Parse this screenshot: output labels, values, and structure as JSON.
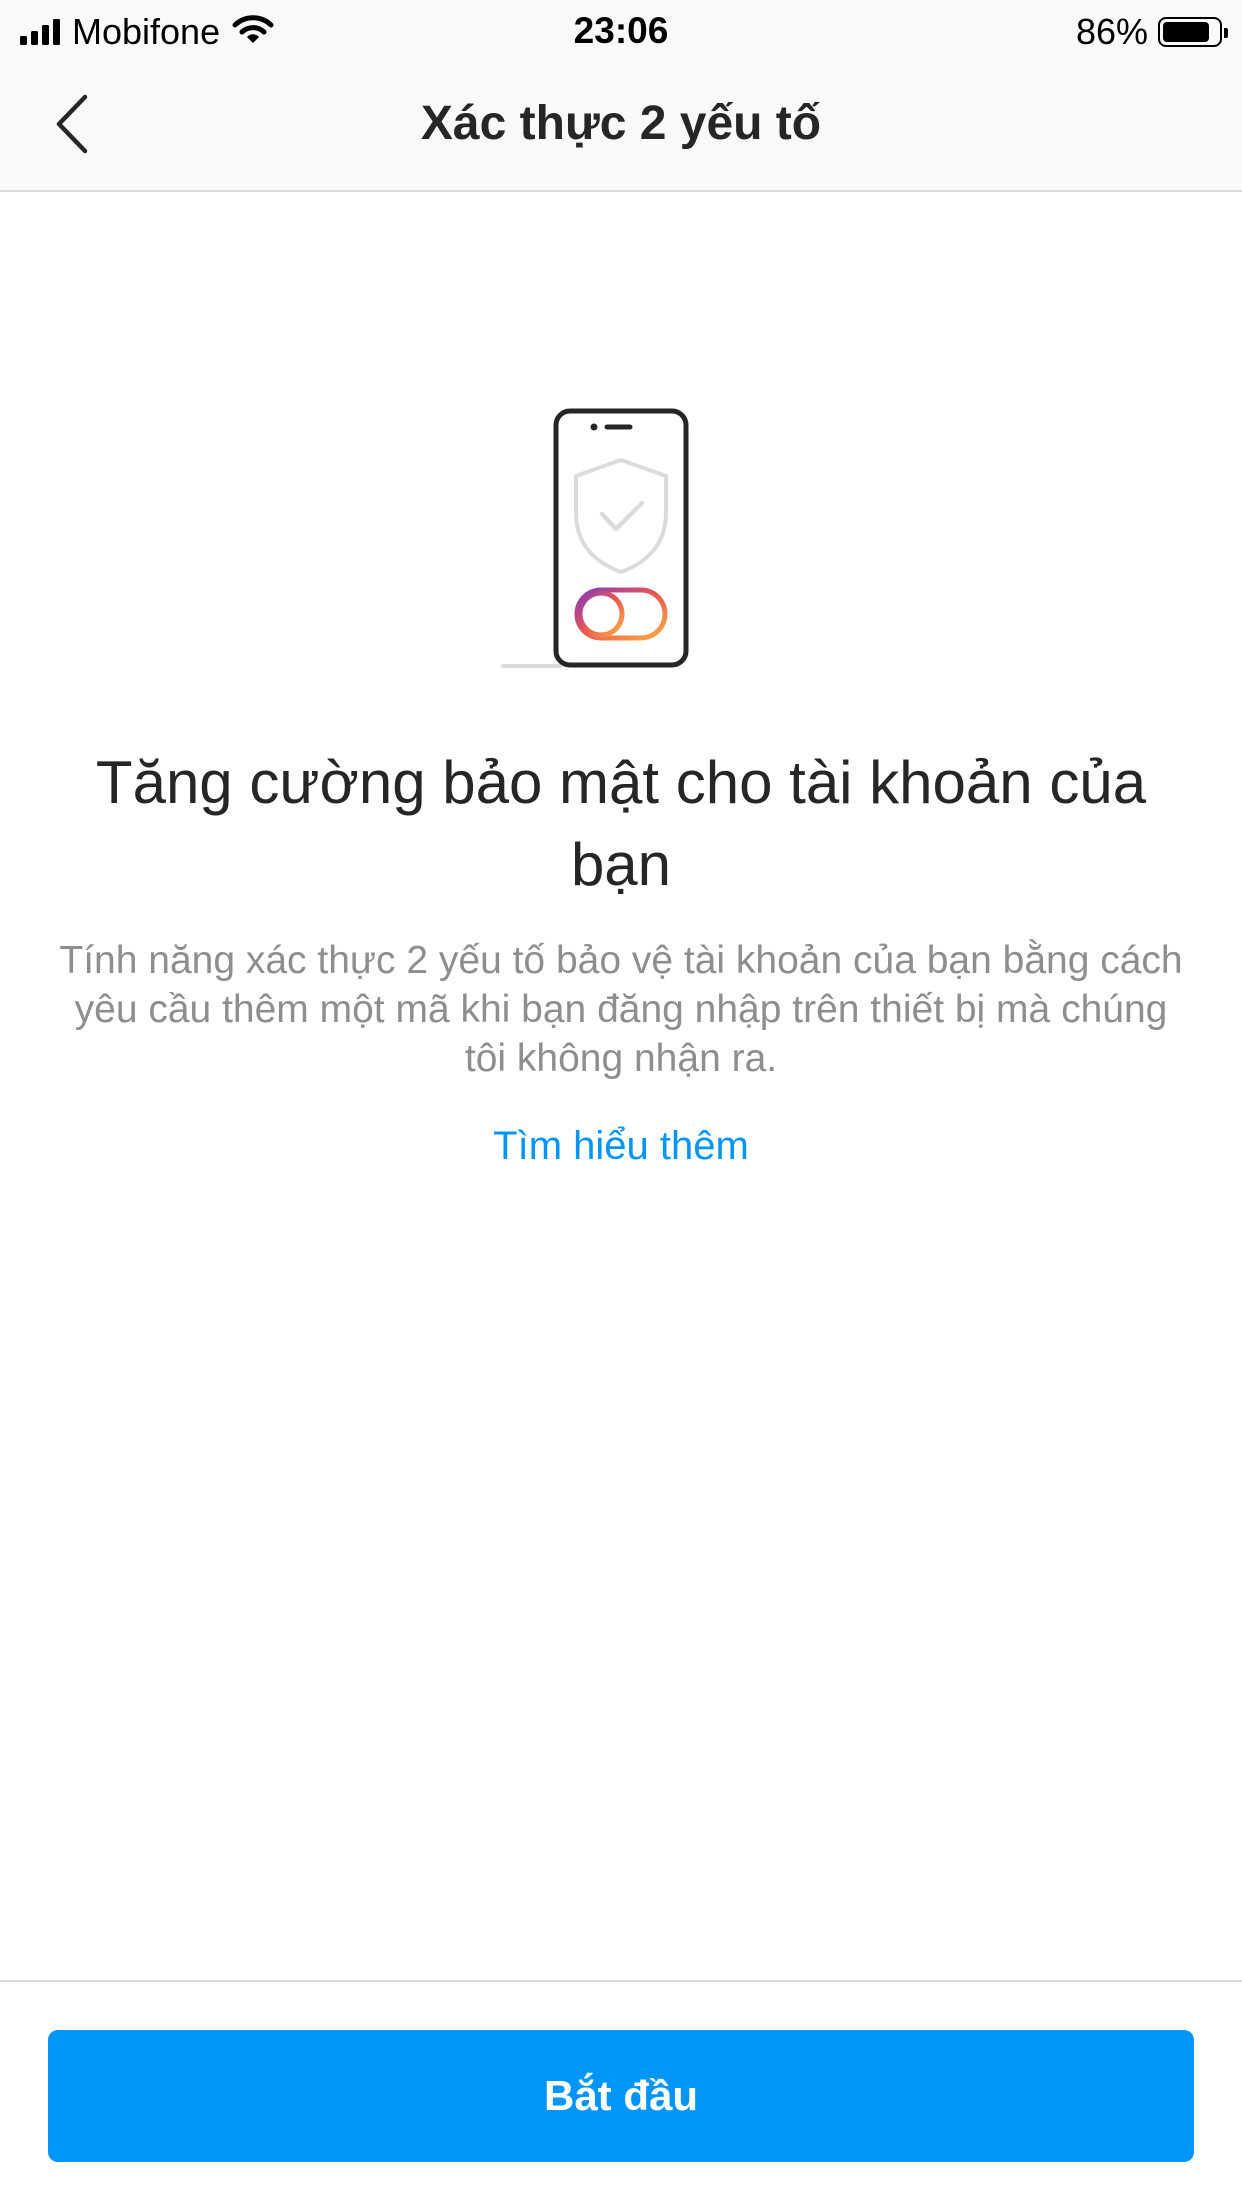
{
  "status_bar": {
    "carrier": "Mobifone",
    "time": "23:06",
    "battery_percent": "86%",
    "battery_level": 0.86,
    "icons": [
      "cellular-signal-icon",
      "wifi-icon",
      "battery-icon"
    ]
  },
  "nav": {
    "back_icon": "chevron-left-icon",
    "title": "Xác thực 2 yếu tố"
  },
  "illustration": {
    "icons": [
      "phone-icon",
      "shield-check-icon",
      "toggle-icon"
    ],
    "colors": {
      "outline": "#262626",
      "shield": "#dbdbdb",
      "toggle_start": "#8a3ab9",
      "toggle_end": "#fcaf45"
    }
  },
  "content": {
    "headline": "Tăng cường bảo mật cho tài khoản của bạn",
    "description": "Tính năng xác thực 2 yếu tố bảo vệ tài khoản của bạn bằng cách yêu cầu thêm một mã khi bạn đăng nhập trên thiết bị mà chúng tôi không nhận ra.",
    "learn_more": "Tìm hiểu thêm"
  },
  "footer": {
    "start_label": "Bắt đầu"
  },
  "colors": {
    "accent": "#0095f6",
    "text_primary": "#262626",
    "text_secondary": "#8e8e8e",
    "divider": "#dbdbdb"
  }
}
